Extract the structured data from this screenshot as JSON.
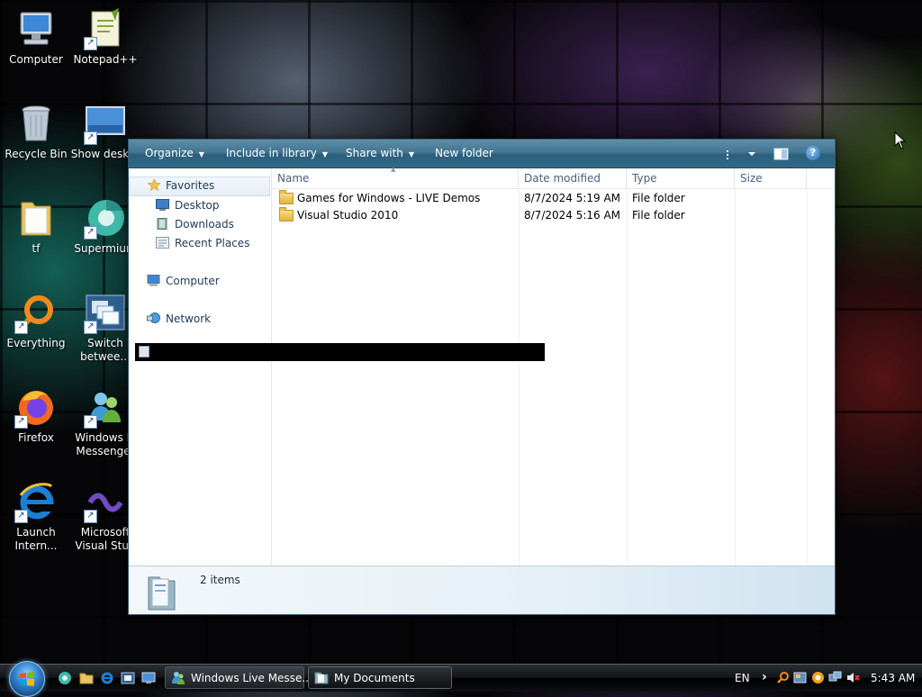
{
  "desktop": {
    "icons": [
      {
        "label": "Computer"
      },
      {
        "label": "Notepad++"
      },
      {
        "label": "Recycle Bin"
      },
      {
        "label": "Show deskto"
      },
      {
        "label": "tf"
      },
      {
        "label": "Supermium"
      },
      {
        "label": "Everything"
      },
      {
        "label": "Switch\nbetwee..."
      },
      {
        "label": "Firefox"
      },
      {
        "label": "Windows Li\nMessenger"
      },
      {
        "label": "Launch\nIntern..."
      },
      {
        "label": "Microsoft\nVisual Stud"
      }
    ]
  },
  "window": {
    "toolbar": {
      "organize": "Organize",
      "include_in_library": "Include in library",
      "share_with": "Share with",
      "new_folder": "New folder",
      "help": "?"
    },
    "nav": {
      "favorites": "Favorites",
      "desktop": "Desktop",
      "downloads": "Downloads",
      "recent_places": "Recent Places",
      "computer": "Computer",
      "network": "Network"
    },
    "columns": {
      "name": "Name",
      "date_modified": "Date modified",
      "type": "Type",
      "size": "Size"
    },
    "files": [
      {
        "name": "Games for Windows - LIVE Demos",
        "date": "8/7/2024 5:19 AM",
        "type": "File folder",
        "size": ""
      },
      {
        "name": "Visual Studio 2010",
        "date": "8/7/2024 5:16 AM",
        "type": "File folder",
        "size": ""
      }
    ],
    "details": {
      "count": "2 items"
    }
  },
  "taskbar": {
    "buttons": [
      {
        "label": "Windows Live Messe..."
      },
      {
        "label": "My Documents"
      }
    ],
    "tray": {
      "language": "EN",
      "expand": "›",
      "clock": "5:43 AM"
    }
  }
}
